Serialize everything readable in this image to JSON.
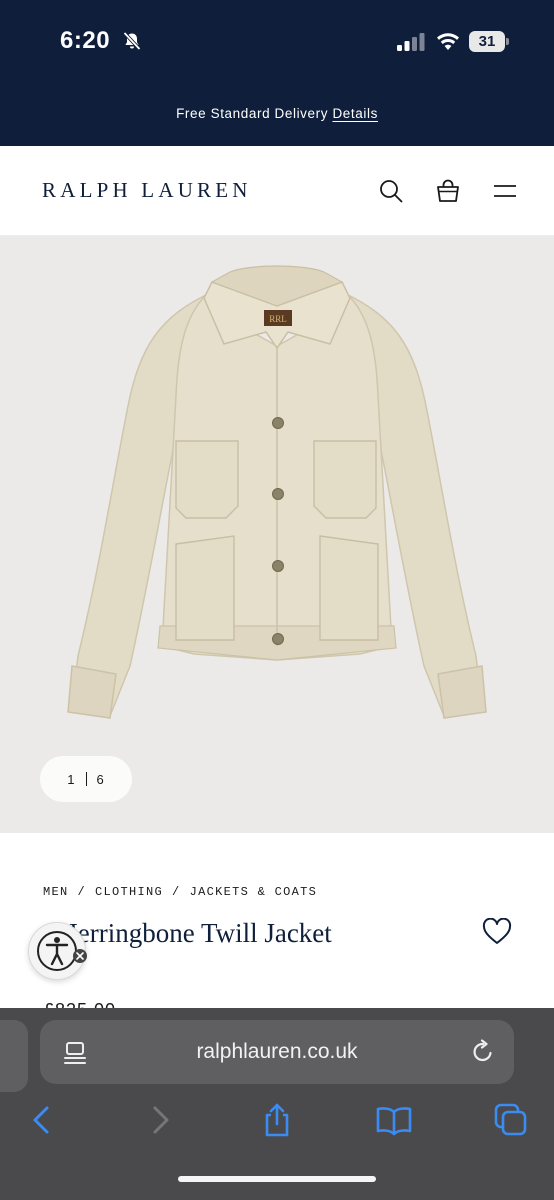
{
  "status_bar": {
    "time": "6:20",
    "battery": "31"
  },
  "promo": {
    "text": "Free Standard Delivery",
    "link": "Details"
  },
  "header": {
    "brand": "RALPH LAUREN"
  },
  "gallery": {
    "current": "1",
    "total": "6"
  },
  "product": {
    "breadcrumb": [
      "MEN",
      "CLOTHING",
      "JACKETS & COATS"
    ],
    "title": "t Herringbone Twill Jacket",
    "price": "£825.00"
  },
  "browser": {
    "url": "ralphlauren.co.uk"
  },
  "colors": {
    "navy": "#0f1f3b",
    "image_bg": "#ebeae8",
    "jacket": "#e3dcc8",
    "toolbar_blue": "#3a8cf3"
  },
  "icons": [
    "bell-slash-icon",
    "signal-icon",
    "wifi-icon",
    "search-icon",
    "bag-icon",
    "menu-icon",
    "heart-icon",
    "accessibility-icon",
    "reader-icon",
    "reload-icon",
    "back-icon",
    "forward-icon",
    "share-icon",
    "bookmarks-icon",
    "tabs-icon"
  ]
}
